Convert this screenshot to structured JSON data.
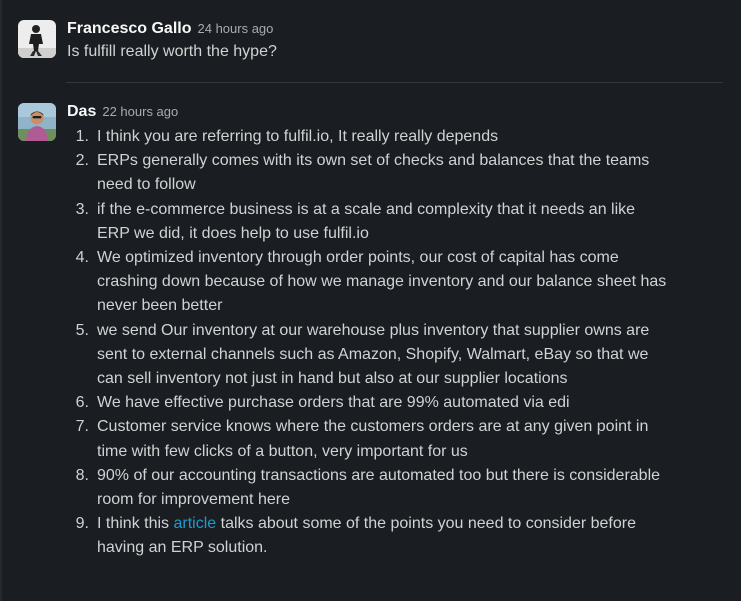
{
  "messages": [
    {
      "author": "Francesco Gallo",
      "timestamp": "24 hours ago",
      "text": "Is fulfill really worth the hype?"
    },
    {
      "author": "Das",
      "timestamp": "22 hours ago",
      "items": [
        {
          "num": "1.",
          "text": "I think you are referring to fulfil.io, It really really depends"
        },
        {
          "num": "2.",
          "text": "ERPs generally comes with its own set of checks and balances that the teams need to follow"
        },
        {
          "num": "3.",
          "text": "if the e-commerce business is at a scale and complexity that it needs an like ERP we did, it does help to use fulfil.io"
        },
        {
          "num": "4.",
          "text": "We optimized inventory through order points, our cost of capital has come crashing down because of how we manage inventory and our balance sheet has never been better"
        },
        {
          "num": "5.",
          "text": "we send Our inventory at our warehouse plus inventory that supplier owns are sent to external channels such as Amazon, Shopify, Walmart, eBay so that we can sell inventory not just in hand but also at our supplier locations"
        },
        {
          "num": "6.",
          "text": "We have effective purchase orders that are 99% automated via edi"
        },
        {
          "num": "7.",
          "text": "Customer service knows where the customers orders are at any given point in time with few clicks of a button, very important for us"
        },
        {
          "num": "8.",
          "text": "90% of our accounting transactions are automated too but there is considerable room for improvement here"
        },
        {
          "num": "9.",
          "before": "I think this ",
          "link": "article",
          "after": " talks about some of the points you need to consider before having an ERP solution."
        }
      ]
    }
  ],
  "colors": {
    "background": "#1a1d21",
    "text": "#d1d2d3",
    "link": "#1d9bd1",
    "timestamp": "#ababad"
  }
}
